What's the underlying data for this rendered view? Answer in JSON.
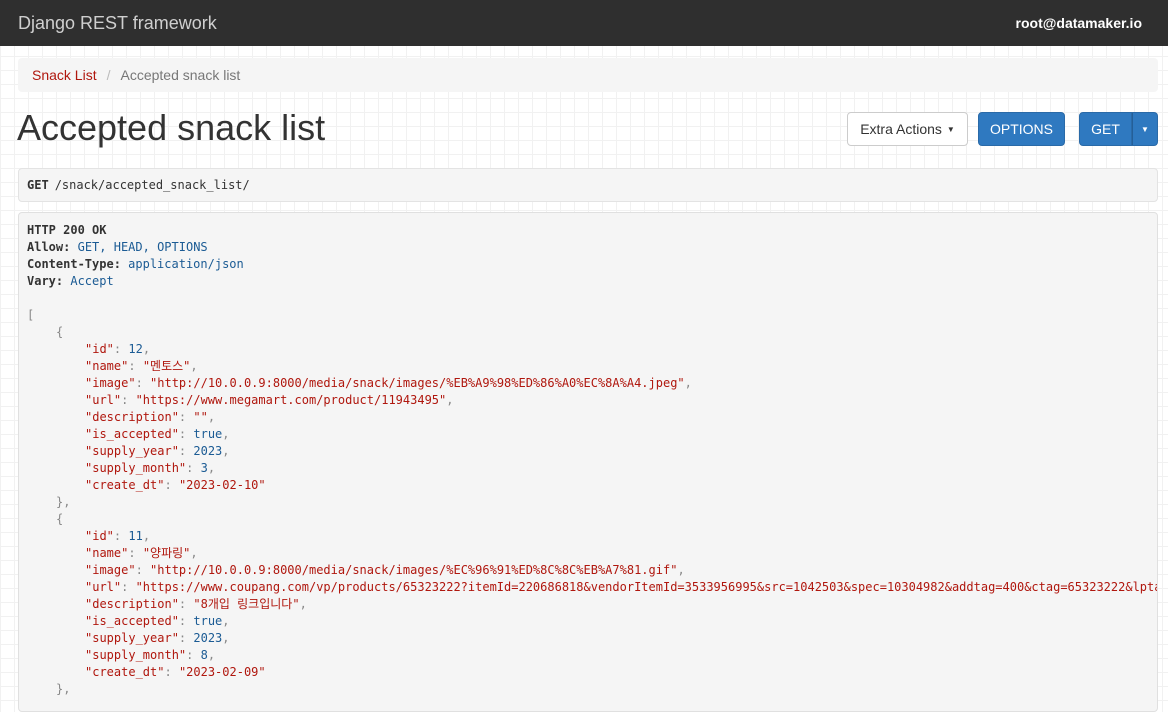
{
  "navbar": {
    "brand": "Django REST framework",
    "user": "root@datamaker.io"
  },
  "breadcrumb": {
    "items": [
      "Snack List",
      "Accepted snack list"
    ],
    "separator": "/"
  },
  "page": {
    "title": "Accepted snack list"
  },
  "toolbar": {
    "extra_actions_label": "Extra Actions",
    "options_label": "OPTIONS",
    "get_label": "GET"
  },
  "request": {
    "method": "GET",
    "path": "/snack/accepted_snack_list/"
  },
  "response": {
    "status": "HTTP 200 OK",
    "headers": [
      {
        "name": "Allow:",
        "value": "GET, HEAD, OPTIONS"
      },
      {
        "name": "Content-Type:",
        "value": "application/json"
      },
      {
        "name": "Vary:",
        "value": "Accept"
      }
    ],
    "items": [
      {
        "id": "12",
        "name": "\"멘토스\"",
        "image": "\"http://10.0.0.9:8000/media/snack/images/%EB%A9%98%ED%86%A0%EC%8A%A4.jpeg\"",
        "url": "\"https://www.megamart.com/product/11943495\"",
        "description": "\"\"",
        "is_accepted": "true",
        "supply_year": "2023",
        "supply_month": "3",
        "create_dt": "\"2023-02-10\""
      },
      {
        "id": "11",
        "name": "\"양파링\"",
        "image": "\"http://10.0.0.9:8000/media/snack/images/%EC%96%91%ED%8C%8C%EB%A7%81.gif\"",
        "url": "\"https://www.coupang.com/vp/products/65323222?itemId=220686818&vendorItemId=3533956995&src=1042503&spec=10304982&addtag=400&ctag=65323222&lpta",
        "description": "\"8개입 링크입니다\"",
        "is_accepted": "true",
        "supply_year": "2023",
        "supply_month": "8",
        "create_dt": "\"2023-02-09\""
      }
    ]
  },
  "colors": {
    "navbar_bg": "#2f2f2f",
    "primary": "#2f79c0",
    "link": "#b0170e",
    "json_string": "#b0170e",
    "json_literal": "#1b5b94"
  }
}
